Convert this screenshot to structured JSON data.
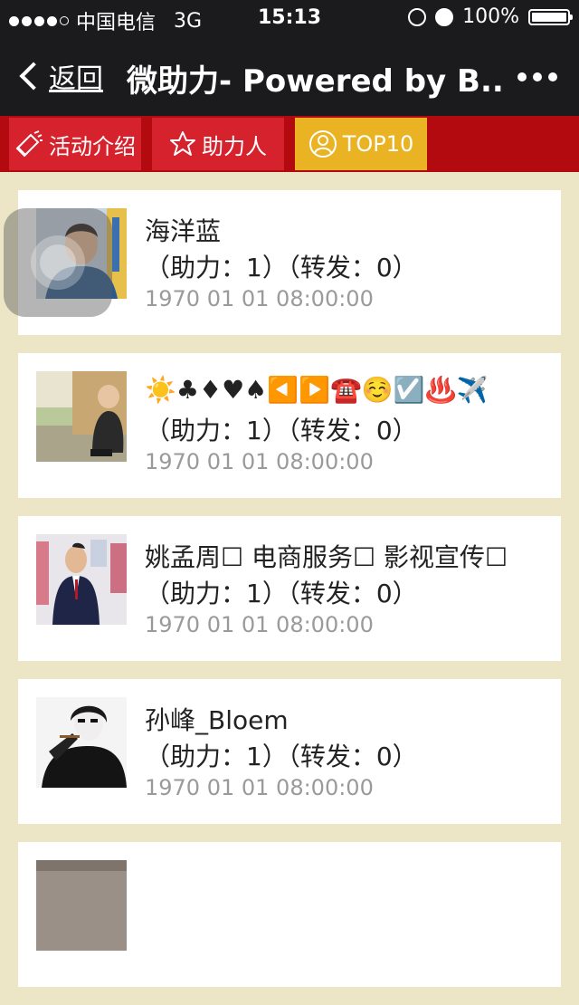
{
  "status_bar": {
    "carrier": "中国电信",
    "network": "3G",
    "time": "15:13",
    "battery": "100%",
    "battery_level": 1.0
  },
  "nav": {
    "back_label": "返回",
    "title": "微助力- Powered by B...",
    "more_icon": "ellipsis-icon"
  },
  "tabs": [
    {
      "label": "活动介绍",
      "icon": "megaphone-icon",
      "color": "#d6222d"
    },
    {
      "label": "助力人",
      "icon": "star-icon",
      "color": "#d6222d"
    },
    {
      "label": "TOP10",
      "icon": "user-circle-icon",
      "color": "#e9b324"
    }
  ],
  "items": [
    {
      "name": "海洋蓝",
      "stats": "（助力：1）（转发：0）",
      "time": "1970 01 01 08:00:00"
    },
    {
      "name": "☀️♣♦♥♠◀️▶️☎️☺️☑️♨️✈️",
      "stats": "（助力：1）（转发：0）",
      "time": "1970 01 01 08:00:00"
    },
    {
      "name": "姚孟周☐ 电商服务☐ 影视宣传☐",
      "stats": "（助力：1）（转发：0）",
      "time": "1970 01 01 08:00:00"
    },
    {
      "name": "孙峰_Bloem",
      "stats": "（助力：1）（转发：0）",
      "time": "1970 01 01 08:00:00"
    },
    {
      "name": "",
      "stats": "",
      "time": ""
    }
  ],
  "colors": {
    "nav_bg": "#1b1b1e",
    "tabbar_bg": "#b20a0f",
    "tab_red": "#d6222d",
    "tab_active": "#e9b324",
    "page_bg": "#ede6c6"
  }
}
